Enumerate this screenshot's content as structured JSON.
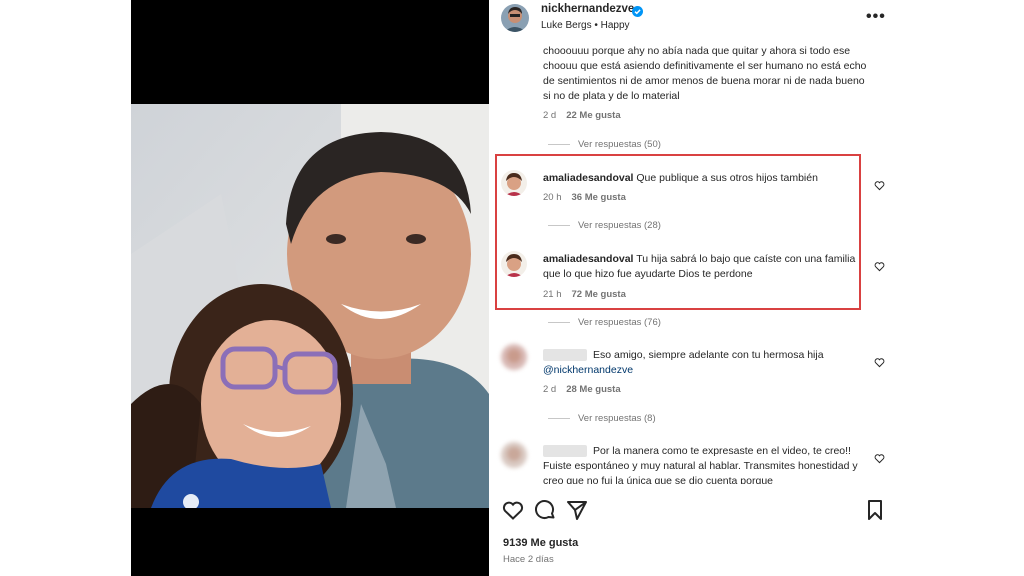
{
  "post": {
    "username": "nickhernandezve",
    "audio": "Luke Bergs • Happy",
    "likes": "9139 Me gusta",
    "date": "Hace 2 días"
  },
  "icons": {
    "more": "more-options-icon",
    "verified": "verified-badge-icon",
    "heart": "heart-icon",
    "comment": "comment-icon",
    "share": "share-icon",
    "save": "bookmark-icon"
  },
  "colors": {
    "highlight_border": "#d94141",
    "verified": "#0095f6",
    "mention": "#00376b"
  },
  "comments": [
    {
      "text": "chooouuu porque ahy no abía nada que quitar y ahora si todo ese choouu que está asiendo definitivamente el ser humano no está echo de sentimientos ni de amor menos de buena morar ni de nada bueno si no de plata y de lo material",
      "time": "2 d",
      "likes": "22 Me gusta",
      "replies": "Ver respuestas (50)"
    },
    {
      "username": "amaliadesandoval",
      "text": "Que publique a sus otros hijos también",
      "time": "20 h",
      "likes": "36 Me gusta",
      "replies": "Ver respuestas (28)"
    },
    {
      "username": "amaliadesandoval",
      "text": "Tu hija sabrá lo bajo que caíste con una familia que lo que hizo fue ayudarte Dios te perdone",
      "time": "21 h",
      "likes": "72 Me gusta",
      "replies": "Ver respuestas (76)"
    },
    {
      "text": "Eso amigo, siempre adelante con tu hermosa hija",
      "mention": "@nickhernandezve",
      "time": "2 d",
      "likes": "28 Me gusta",
      "replies": "Ver respuestas (8)"
    },
    {
      "text": "Por la manera como te expresaste en el video, te creo!! Fuiste espontáneo y muy natural al hablar. Transmites honestidad y creo que no fui la única que se dio cuenta porque"
    }
  ]
}
